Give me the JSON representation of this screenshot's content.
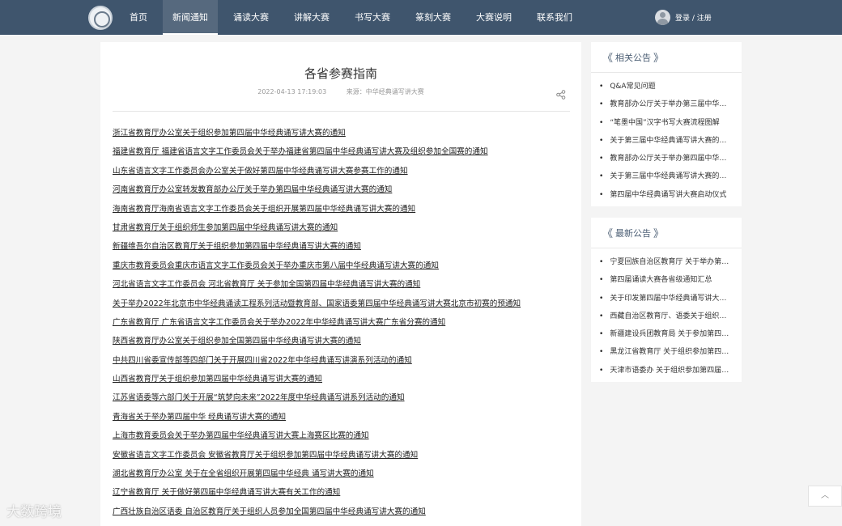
{
  "nav": {
    "items": [
      "首页",
      "新闻通知",
      "诵读大赛",
      "讲解大赛",
      "书写大赛",
      "篆刻大赛",
      "大赛说明",
      "联系我们"
    ],
    "active_index": 1,
    "login_label": "登录 / 注册"
  },
  "article": {
    "title": "各省参赛指南",
    "date": "2022-04-13 17:19:03",
    "source": "来源：中华经典诵写讲大赛",
    "links": [
      "浙江省教育厅办公室关于组织参加第四届中华经典诵写讲大赛的通知",
      "福建省教育厅 福建省语言文字工作委员会关于举办福建省第四届中华经典诵写讲大赛及组织参加全国赛的通知",
      "山东省语言文字工作委员会办公室关于做好第四届中华经典诵写讲大赛参赛工作的通知",
      "河南省教育厅办公室转发教育部办公厅关于举办第四届中华经典诵写讲大赛的通知",
      "海南省教育厅海南省语言文字工作委员会关于组织开展第四届中华经典诵写讲大赛的通知",
      "甘肃省教育厅关于组织师生参加第四届中华经典诵写讲大赛的通知",
      "新疆维吾尔自治区教育厅关于组织参加第四届中华经典诵写讲大赛的通知",
      "重庆市教育委员会重庆市语言文字工作委员会关于举办重庆市第八届中华经典诵写讲大赛的通知",
      "河北省语言文字工作委员会 河北省教育厅 关于参加全国第四届中华经典诵写讲大赛的通知",
      "关于举办2022年北京市中华经典诵读工程系列活动暨教育部、国家语委第四届中华经典诵写讲大赛北京市初赛的预通知",
      "广东省教育厅 广东省语言文字工作委员会关于举办2022年中华经典诵写讲大赛广东省分赛的通知",
      "陕西省教育厅办公室关于组织参加全国第四届中华经典诵写讲大赛的通知",
      "中共四川省委宣传部等四部门关于开展四川省2022年中华经典诵写讲演系列活动的通知",
      "山西省教育厅关于组织参加第四届中华经典诵写讲大赛的通知",
      "江苏省语委等六部门关于开展“筑梦向未来”2022年度中华经典诵写讲系列活动的通知",
      "青海省关于举办第四届中华 经典诵写讲大赛的通知",
      "上海市教育委员会关于举办第四届中华经典诵写讲大赛上海赛区比赛的通知",
      "安徽省语言文字工作委员会 安徽省教育厅关于组织参加第四届中华经典诵写讲大赛的通知",
      "湖北省教育厅办公室 关于在全省组织开展第四届中华经典 诵写讲大赛的通知",
      "辽宁省教育厅 关于做好第四届中华经典诵写讲大赛有关工作的通知",
      "广西壮族自治区语委 自治区教育厅关于组织人员参加全国第四届中华经典诵写讲大赛的通知"
    ]
  },
  "sidebar": {
    "related": {
      "title": "相关公告",
      "items": [
        "Q&A常见问题",
        "教育部办公厅关于举办第三届中华经典诵写讲大赛的通知",
        "“笔墨中国”汉字书写大赛流程图解",
        "关于第三届中华经典诵写讲大赛的说明",
        "教育部办公厅关于举办第四届中华经典诵写讲大赛的通知",
        "关于第三届中华经典诵写讲大赛的通知",
        "第四届中华经典诵写讲大赛启动仪式"
      ]
    },
    "latest": {
      "title": "最新公告",
      "items": [
        "宁夏回族自治区教育厅 关于举办第四届中华经典诵写讲大赛的通知",
        "第四届诵读大赛各省级通知汇总",
        "关于印发第四届中华经典诵写讲大赛的通知",
        "西藏自治区教育厅、语委关于组织参加第四届大赛的通知",
        "新疆建设兵团教育局 关于参加第四届大赛的通知",
        "黑龙江省教育厅 关于组织参加第四届大赛的通知",
        "天津市语委办 关于组织参加第四届大赛的通知"
      ]
    }
  },
  "watermark": "大数跨境",
  "colors": {
    "nav_bg": "#3f556d",
    "accent": "#4a5d73"
  },
  "icons": {
    "share": "share-icon",
    "to_top": "chevron-up-icon"
  }
}
